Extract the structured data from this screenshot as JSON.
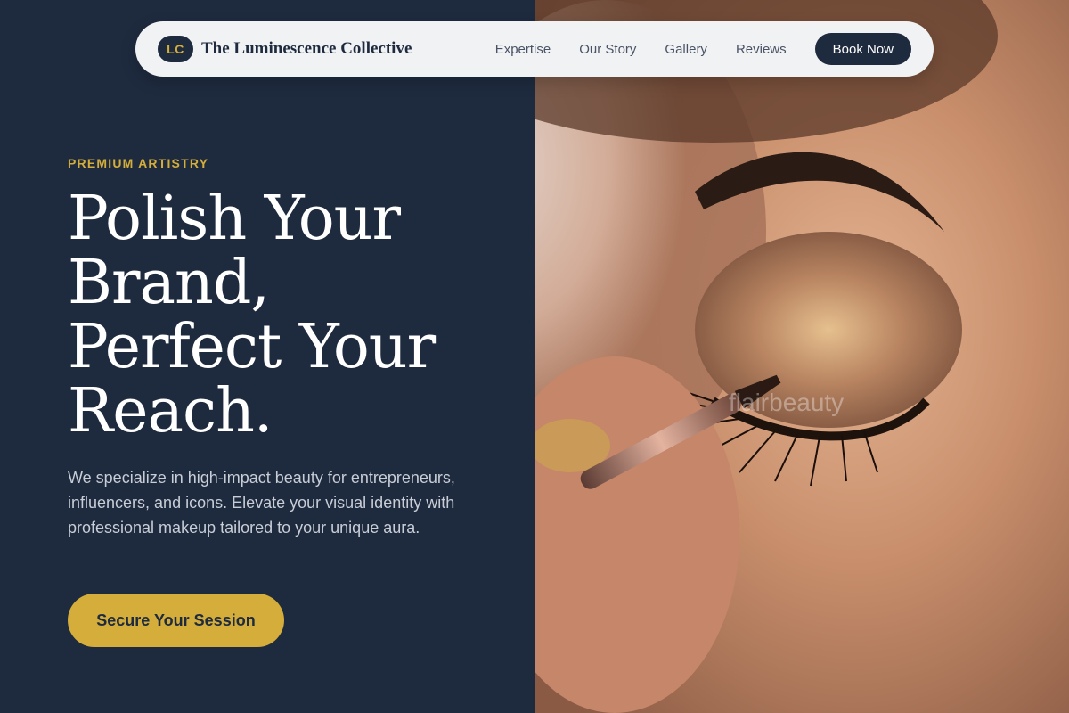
{
  "brand": {
    "logo_initials": "LC",
    "name": "The Luminescence Collective"
  },
  "nav": {
    "links": [
      "Expertise",
      "Our Story",
      "Gallery",
      "Reviews"
    ],
    "book_label": "Book Now"
  },
  "hero": {
    "eyebrow": "PREMIUM ARTISTRY",
    "headline_lines": [
      "Polish Your",
      "Brand,",
      "Perfect Your",
      "Reach."
    ],
    "description": "We specialize in high-impact beauty for entrepreneurs, influencers, and icons. Elevate your visual identity with professional makeup tailored to your unique aura.",
    "cta_label": "Secure Your Session"
  },
  "image": {
    "subject": "close-up of eye makeup being applied with a brush",
    "watermark": "flairbeauty"
  },
  "colors": {
    "navy": "#1e2a3e",
    "gold": "#d4ad3a",
    "nav_bg": "#f1f2f4",
    "text_light": "#c8cdd6"
  }
}
